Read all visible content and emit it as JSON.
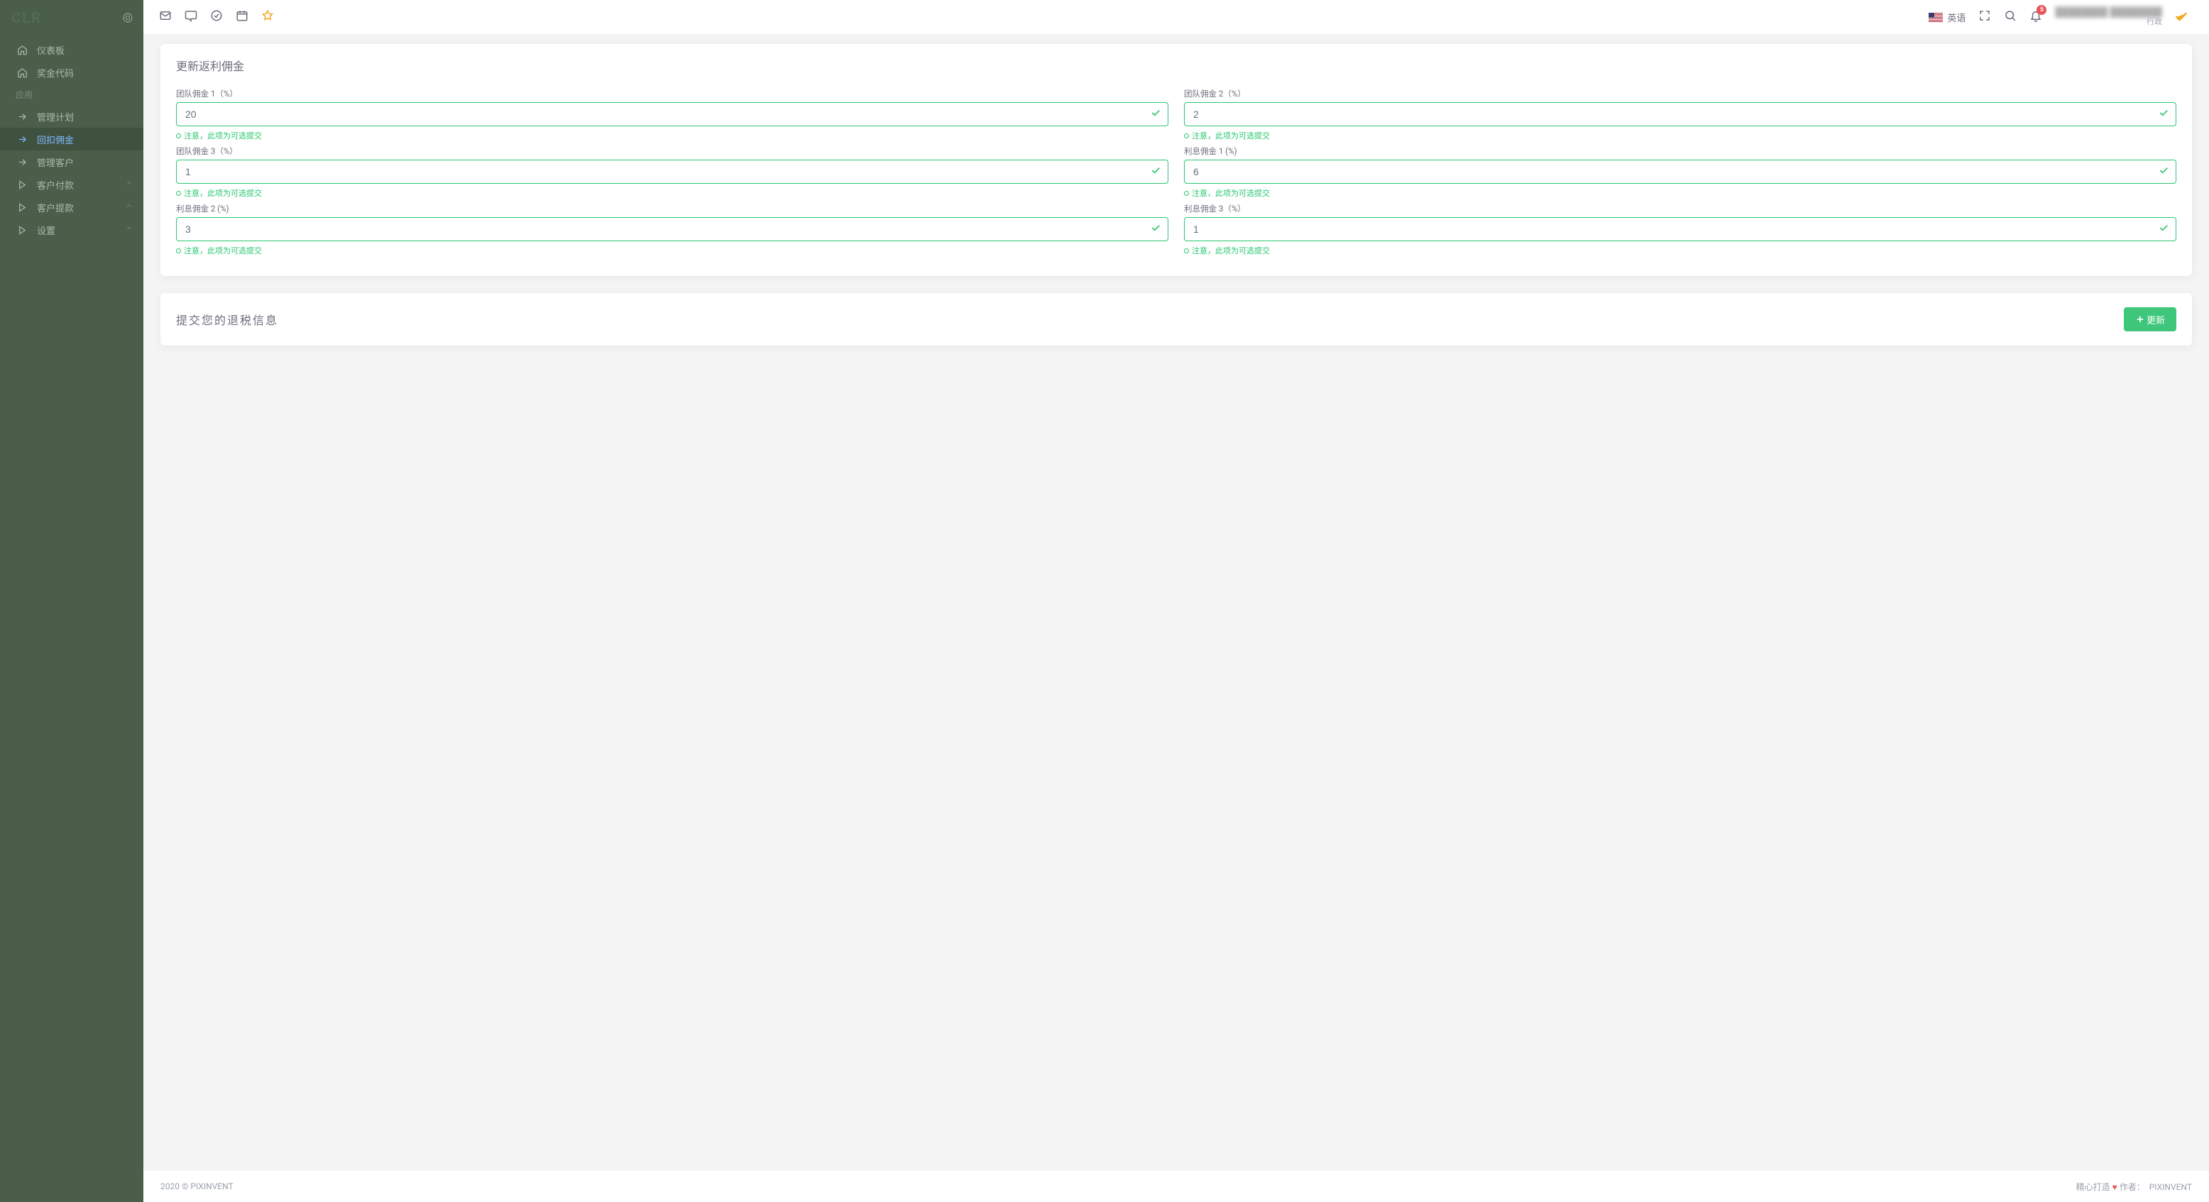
{
  "brand": {
    "logo": "CLR"
  },
  "sidebar": {
    "items": [
      {
        "label": "仪表板",
        "icon": "home"
      },
      {
        "label": "奖金代码",
        "icon": "home"
      }
    ],
    "section": "应用",
    "app_items": [
      {
        "label": "管理计划"
      },
      {
        "label": "回扣佣金"
      },
      {
        "label": "管理客户"
      },
      {
        "label": "客户付款"
      },
      {
        "label": "客户提款"
      },
      {
        "label": "设置"
      }
    ]
  },
  "topbar": {
    "lang": "英语",
    "notif_count": "5",
    "user_name": "████████ ████████",
    "user_role": "行政"
  },
  "card1": {
    "title": "更新返利佣金",
    "optional_hint": "注意，此项为可选提交",
    "fields": {
      "tc1": {
        "label": "团队佣金 1（%）",
        "value": "20"
      },
      "tc2": {
        "label": "团队佣金 2（%）",
        "value": "2"
      },
      "tc3": {
        "label": "团队佣金 3（%）",
        "value": "1"
      },
      "ic1": {
        "label": "利息佣金 1 (%)",
        "value": "6"
      },
      "ic2": {
        "label": "利息佣金 2 (%)",
        "value": "3"
      },
      "ic3": {
        "label": "利息佣金 3（%）",
        "value": "1"
      }
    }
  },
  "card2": {
    "title": "提交您的退税信息",
    "button": "更新"
  },
  "footer": {
    "left": "2020 © PIXINVENT",
    "right_prefix": "精心打造",
    "right_mid": "作者：",
    "right_author": "PIXINVENT"
  }
}
